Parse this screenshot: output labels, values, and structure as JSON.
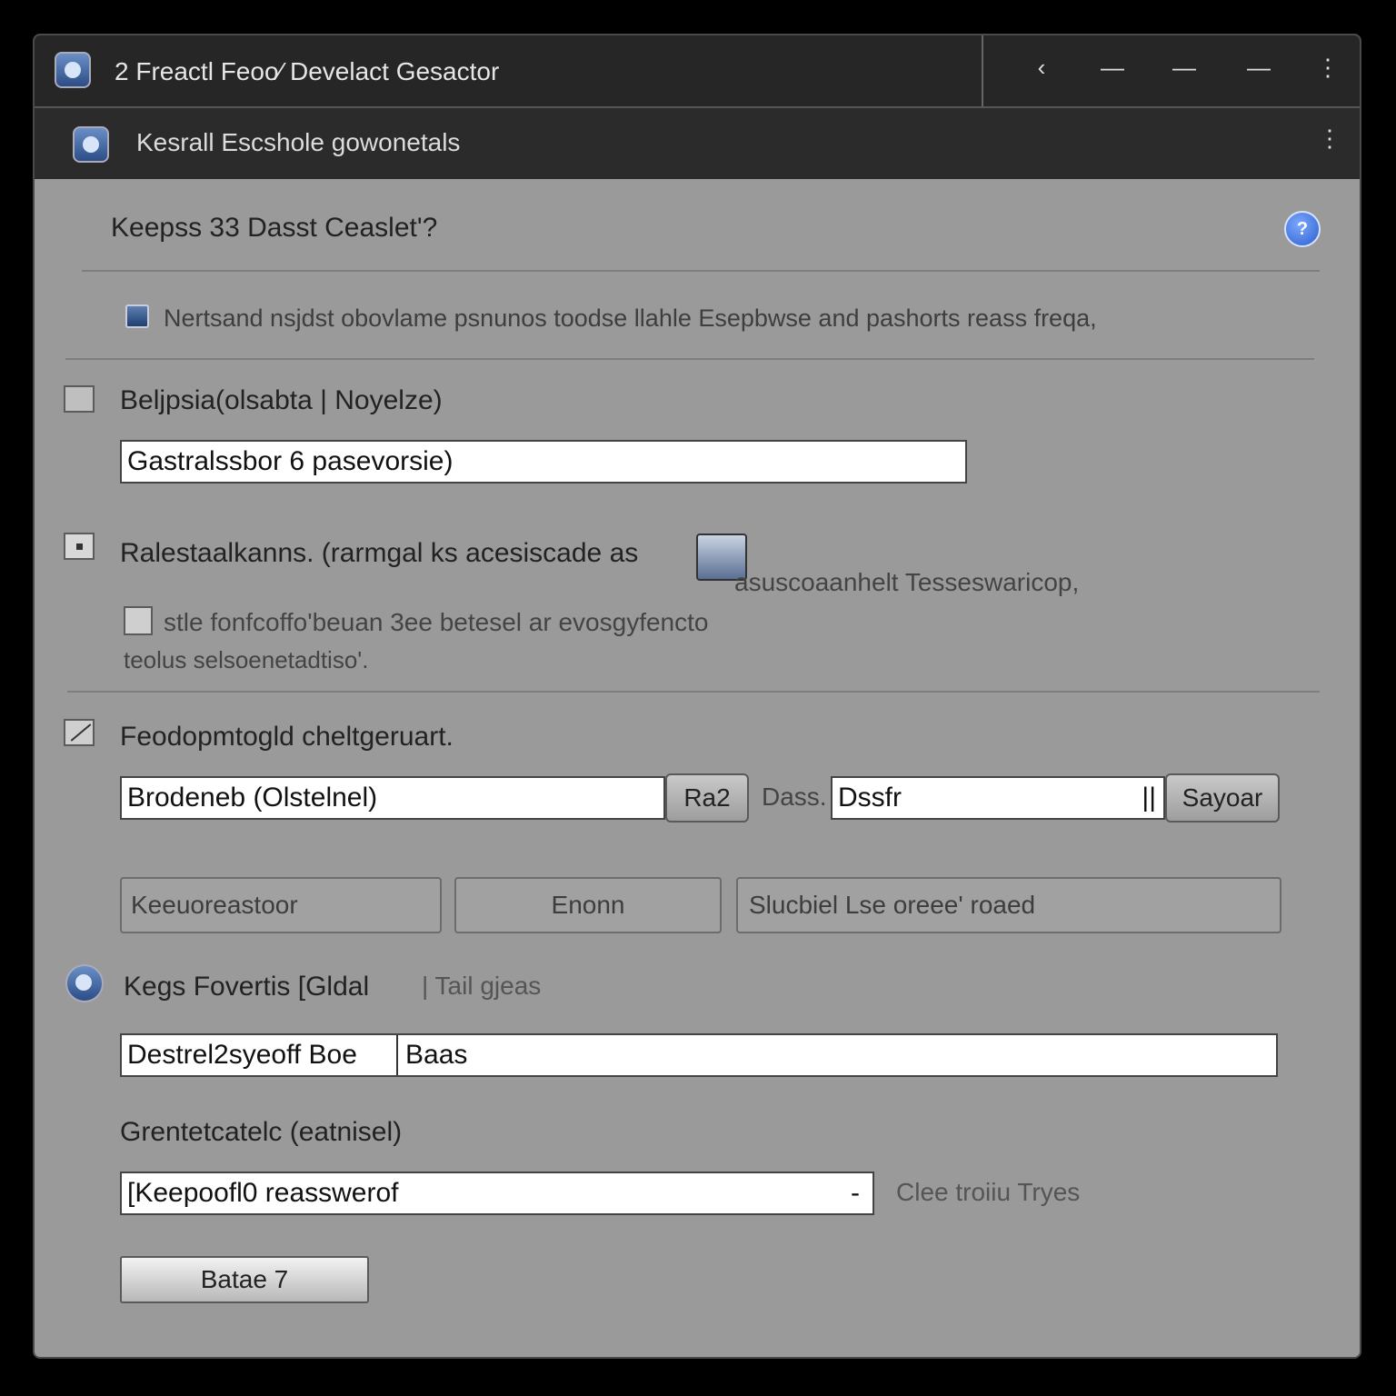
{
  "window": {
    "title": "2 Freactl Feoo⁄ Develact Gesactor",
    "buttons": [
      "‹",
      "—",
      "—",
      "—",
      "⋮"
    ]
  },
  "header": {
    "title": "Kesrall Escshole gowonetals",
    "menu": "⋮"
  },
  "content": {
    "title": "Keepss 33 Dasst Ceaslet'?",
    "help": "?",
    "info": "Nertsand nsjdst obovlame psnunos toodse llahle Esepbwse and pashorts reass freqa,"
  },
  "section1": {
    "checkbox_label": "Beljpsia(olsabta | Noyelze)",
    "input_value": "Gastralssbor 6 pasevorsie)"
  },
  "section2": {
    "checkbox_label": "Ralestaalkanns. (rarmgal ks acesiscade as",
    "side_text": "asuscoaanhelt Tesseswaricop,",
    "sub_checkbox_text": "stle fonfcoffo'beuan 3ee betesel ar evosgyfencto",
    "sub_text2": "teolus selsoenetadtiso'."
  },
  "section3": {
    "checkbox_label": "Feodopmtogld cheltgeruart.",
    "input1_value": "Brodeneb (Olstelnel)",
    "btn1": "Ra2",
    "label_mid": "Dass.",
    "input2_value": "Dssfr",
    "input2_suffix": "||",
    "btn2": "Sayoar",
    "field_a": "Keeuoreastoor",
    "field_b": "Enonn",
    "field_c": "Slucbiel Lse oreee' roaed"
  },
  "section4": {
    "label": "Kegs Fovertis [Gldal",
    "label_muted": "| Tail gjeas",
    "input_left": "Destrel2syeoff Boe",
    "input_right": "Baas"
  },
  "section5": {
    "label": "Grentetcatelc (eatnisel)",
    "select_value": "[Keepoofl0 reasswerof",
    "select_arrow": "-",
    "side_text": "Clee troiiu  Tryes",
    "button": "Batae 7"
  }
}
